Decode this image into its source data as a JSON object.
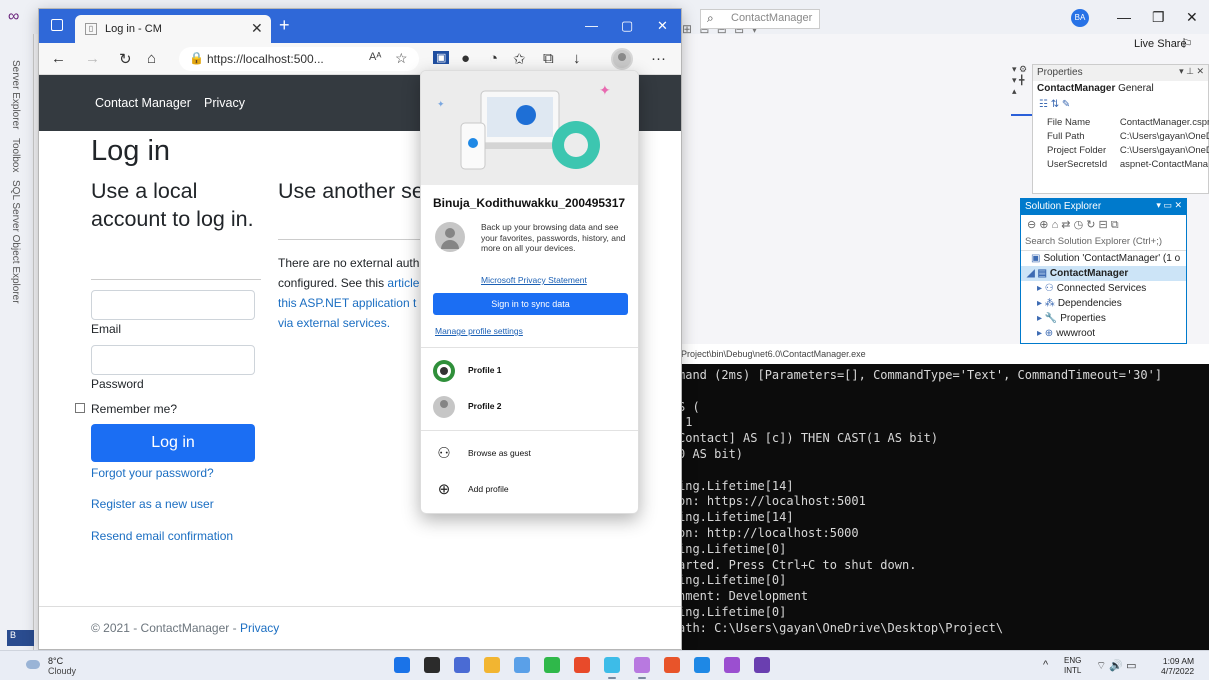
{
  "vs": {
    "search_placeholder": "ContactManager",
    "avatar_initials": "BA",
    "live_share": "Live Share",
    "sidebar_tabs": [
      "Server Explorer",
      "Toolbox",
      "SQL Server Object Explorer"
    ],
    "bottom_tab": "B",
    "properties": {
      "title": "Properties",
      "object": "ContactManager",
      "object_type": "General",
      "rows": [
        {
          "name": "File Name",
          "value": "ContactManager.cspr"
        },
        {
          "name": "Full Path",
          "value": "C:\\Users\\gayan\\OneD"
        },
        {
          "name": "Project Folder",
          "value": "C:\\Users\\gayan\\OneD"
        },
        {
          "name": "UserSecretsId",
          "value": "aspnet-ContactMana"
        }
      ]
    },
    "solution_explorer": {
      "title": "Solution Explorer",
      "search_placeholder": "Search Solution Explorer (Ctrl+;)",
      "items": [
        "Solution 'ContactManager' (1 o",
        "ContactManager",
        "Connected Services",
        "Dependencies",
        "Properties",
        "wwwroot"
      ]
    },
    "console": {
      "title": "top\\Project\\bin\\Debug\\net6.0\\ContactManager.exe",
      "lines": [
        "mand (2ms) [Parameters=[], CommandType='Text', CommandTimeout='30']",
        "",
        "S (",
        " 1",
        "Contact] AS [c]) THEN CAST(1 AS bit)",
        "0 AS bit)",
        "",
        "ing.Lifetime[14]",
        "on: https://localhost:5001",
        "ing.Lifetime[14]",
        "on: http://localhost:5000",
        "ing.Lifetime[0]",
        "arted. Press Ctrl+C to shut down.",
        "ing.Lifetime[0]",
        "nment: Development",
        "ing.Lifetime[0]",
        "ath: C:\\Users\\gayan\\OneDrive\\Desktop\\Project\\"
      ]
    }
  },
  "browser": {
    "tab_title": "Log in - CM",
    "url": "https://localhost:500...",
    "page": {
      "nav_brand": "Contact Manager",
      "nav_privacy": "Privacy",
      "heading": "Log in",
      "subheading": "Use a local account to log in.",
      "other_heading": "Use another se log in.",
      "external_text_1": "There are no external auth",
      "external_text_2": "configured. See this",
      "external_link_1": "article",
      "external_link_2": "this ASP.NET application t",
      "external_link_3": "via external services.",
      "email_label": "Email",
      "password_label": "Password",
      "remember_label": "Remember me?",
      "login_button": "Log in",
      "forgot_link": "Forgot your password?",
      "register_link": "Register as a new user",
      "resend_link": "Resend email confirmation",
      "footer_text": "© 2021 - ContactManager -",
      "footer_link": "Privacy"
    },
    "profile_flyout": {
      "user_name": "Binuja_Kodithuwakku_200495317",
      "description": "Back up your browsing data and see your favorites, passwords, history, and more on all your devices.",
      "privacy_link": "Microsoft Privacy Statement",
      "sync_button": "Sign in to sync data",
      "manage_link": "Manage profile settings",
      "profiles": [
        "Profile 1",
        "Profile 2"
      ],
      "guest": "Browse as guest",
      "add_profile": "Add profile"
    }
  },
  "taskbar": {
    "temperature": "8°C",
    "weather": "Cloudy",
    "lang_1": "ENG",
    "lang_2": "INTL",
    "time": "1:09 AM",
    "date": "4/7/2022",
    "app_colors": [
      "#1a73e8",
      "#2b2b2b",
      "#4a6bd4",
      "#f2b531",
      "#5aa0e8",
      "#2fb84a",
      "#e84a2a",
      "#3dbce8",
      "#b879e0",
      "#e8542a",
      "#1e88e5",
      "#9b4fd0",
      "#6a3fb0"
    ]
  }
}
